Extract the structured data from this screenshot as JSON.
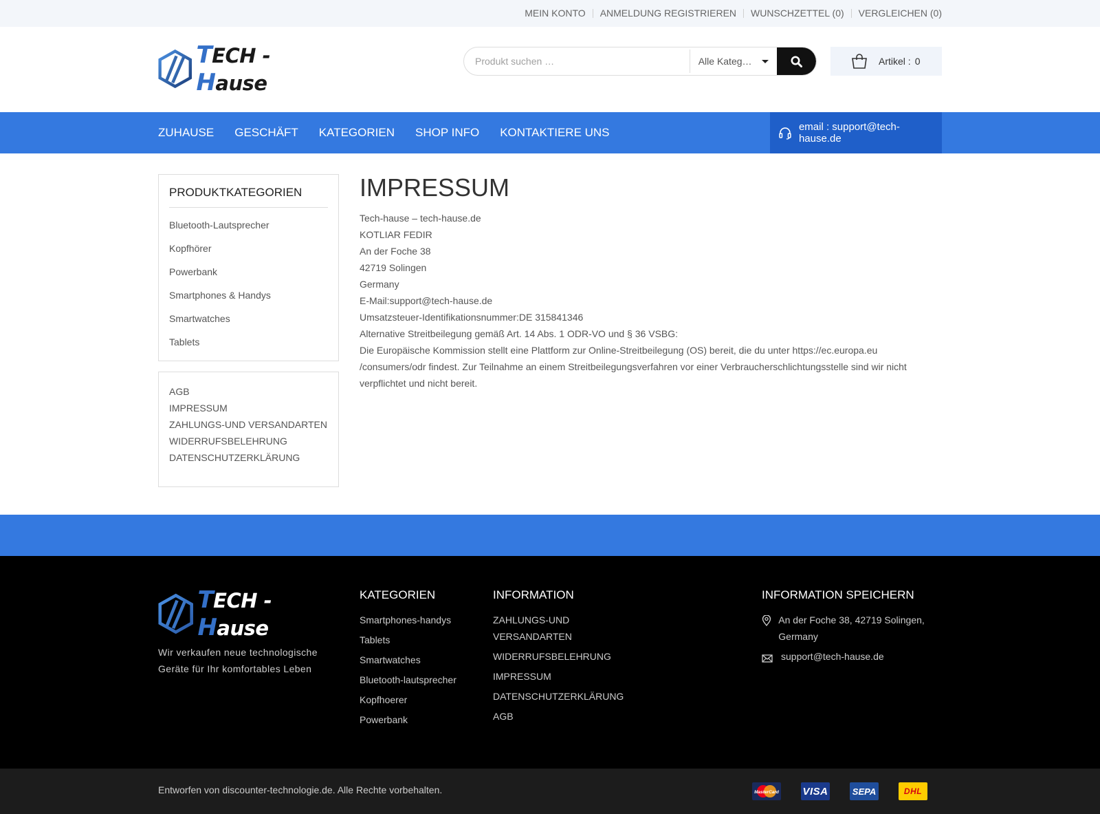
{
  "topbar": {
    "links": [
      "MEIN KONTO",
      "ANMELDUNG REGISTRIEREN",
      "WUNSCHZETTEL (0)",
      "VERGLEICHEN (0)"
    ]
  },
  "header": {
    "logo_letter1": "T",
    "logo_part1": "ECH - ",
    "logo_letter2": "H",
    "logo_part2": "ause",
    "search_placeholder": "Produkt suchen …",
    "category_select": "Alle Kateg…",
    "cart_label": "Artikel :",
    "cart_count": "0"
  },
  "nav": {
    "items": [
      "ZUHAUSE",
      "GESCHÄFT",
      "KATEGORIEN",
      "SHOP INFO",
      "KONTAKTIERE UNS"
    ],
    "email": "email : support@tech-hause.de"
  },
  "sidebar": {
    "title": "PRODUKTKATEGORIEN",
    "categories": [
      "Bluetooth-Lautsprecher",
      "Kopfhörer",
      "Powerbank",
      "Smartphones & Handys",
      "Smartwatches",
      "Tablets"
    ],
    "pages": [
      "AGB",
      "IMPRESSUM",
      "ZAHLUNGS-UND VERSANDARTEN",
      "WIDERRUFSBELEHRUNG",
      "DATENSCHUTZERKLÄRUNG"
    ]
  },
  "content": {
    "title": "IMPRESSUM",
    "lines": [
      "Tech-hause – tech-hause.de",
      "KOTLIAR FEDIR",
      "An der Foche 38",
      "42719 Solingen",
      "Germany",
      "E-Mail:support@tech-hause.de",
      "Umsatzsteuer-Identifikationsnummer:DE 315841346",
      "Alternative Streitbeilegung gemäß Art. 14 Abs. 1 ODR-VO und § 36 VSBG:"
    ],
    "paragraph": "Die Europäische Kommission stellt eine Plattform zur Online-Streitbeilegung (OS) bereit, die du unter https://ec.europa.eu /consumers/odr findest. Zur Teilnahme an einem Streitbeilegungsverfahren vor einer Verbraucherschlichtungsstelle sind wir nicht verpflichtet und nicht bereit."
  },
  "footer": {
    "description": "Wir verkaufen neue technologische Geräte für Ihr komfortables Leben",
    "categories_title": "KATEGORIEN",
    "categories": [
      "Smartphones-handys",
      "Tablets",
      "Smartwatches",
      "Bluetooth-lautsprecher",
      "Kopfhoerer",
      "Powerbank"
    ],
    "information_title": "INFORMATION",
    "information": [
      "ZAHLUNGS-UND VERSANDARTEN",
      "WIDERRUFSBELEHRUNG",
      "IMPRESSUM",
      "DATENSCHUTZERKLÄRUNG",
      "AGB"
    ],
    "store_title": "INFORMATION SPEICHERN",
    "address": "An der Foche 38, 42719 Solingen, Germany",
    "email": "support@tech-hause.de",
    "copyright": "Entworfen von discounter-technologie.de. Alle Rechte vorbehalten.",
    "payments": [
      "MasterCard",
      "VISA",
      "SEPA",
      "DHL"
    ]
  },
  "colors": {
    "accent": "#3479e0",
    "accent_dark": "#1f5fc9",
    "footer_bg": "#000000"
  }
}
